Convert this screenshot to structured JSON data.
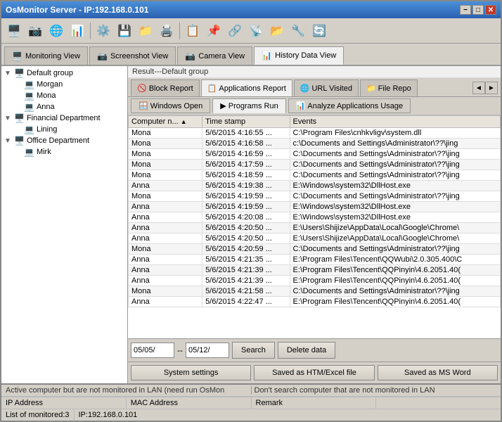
{
  "window": {
    "title": "OsMonitor Server - IP:192.168.0.101",
    "minimize": "−",
    "maximize": "□",
    "close": "✕"
  },
  "toolbar": {
    "icons": [
      "🖥️",
      "📷",
      "🌐",
      "📊",
      "⚙️",
      "💾",
      "📁",
      "🖨️",
      "📋",
      "📌",
      "🔗",
      "📡",
      "📂",
      "🔧",
      "🔄"
    ]
  },
  "tabs": [
    {
      "label": "Monitoring View",
      "icon": "🖥️",
      "active": false
    },
    {
      "label": "Screenshot View",
      "icon": "📷",
      "active": false
    },
    {
      "label": "Camera View",
      "icon": "📷",
      "active": false
    },
    {
      "label": "History Data View",
      "icon": "📊",
      "active": true
    }
  ],
  "sidebar": {
    "tree": [
      {
        "label": "Default group",
        "icon": "🖥️",
        "type": "group",
        "expanded": true,
        "children": [
          {
            "label": "Morgan",
            "icon": "💻",
            "type": "computer"
          },
          {
            "label": "Mona",
            "icon": "💻",
            "type": "computer"
          },
          {
            "label": "Anna",
            "icon": "💻",
            "type": "computer"
          }
        ]
      },
      {
        "label": "Financial Department",
        "icon": "🖥️",
        "type": "group",
        "expanded": true,
        "children": [
          {
            "label": "Lining",
            "icon": "💻",
            "type": "computer"
          }
        ]
      },
      {
        "label": "Office Department",
        "icon": "🖥️",
        "type": "group",
        "expanded": true,
        "children": [
          {
            "label": "Mirk",
            "icon": "💻",
            "type": "computer"
          }
        ]
      }
    ]
  },
  "result_label": "Result---Default group",
  "sub_tabs": [
    {
      "label": "Block Report",
      "icon": "🚫",
      "active": false
    },
    {
      "label": "Applications Report",
      "icon": "📋",
      "active": true
    },
    {
      "label": "URL Visited",
      "icon": "🌐",
      "active": false
    },
    {
      "label": "File Repo",
      "icon": "📁",
      "active": false
    }
  ],
  "action_tabs": [
    {
      "label": "Windows Open",
      "icon": "🪟"
    },
    {
      "label": "Programs Run",
      "icon": "▶️"
    },
    {
      "label": "Analyze Applications Usage",
      "icon": "📊"
    }
  ],
  "table": {
    "columns": [
      "Computer n...",
      "Time stamp",
      "Events"
    ],
    "rows": [
      [
        "Mona",
        "5/6/2015 4:16:55 ...",
        "C:\\Program Files\\cnhkvligv\\system.dll"
      ],
      [
        "Mona",
        "5/6/2015 4:16:58 ...",
        "c:\\Documents and Settings\\Administrator\\??\\jing"
      ],
      [
        "Mona",
        "5/6/2015 4:16:59 ...",
        "C:\\Documents and Settings\\Administrator\\??\\jing"
      ],
      [
        "Mona",
        "5/6/2015 4:17:59 ...",
        "C:\\Documents and Settings\\Administrator\\??\\jing"
      ],
      [
        "Mona",
        "5/6/2015 4:18:59 ...",
        "C:\\Documents and Settings\\Administrator\\??\\jing"
      ],
      [
        "Anna",
        "5/6/2015 4:19:38 ...",
        "E:\\Windows\\system32\\DllHost.exe"
      ],
      [
        "Mona",
        "5/6/2015 4:19:59 ...",
        "C:\\Documents and Settings\\Administrator\\??\\jing"
      ],
      [
        "Anna",
        "5/6/2015 4:19:59 ...",
        "E:\\Windows\\system32\\DllHost.exe"
      ],
      [
        "Anna",
        "5/6/2015 4:20:08 ...",
        "E:\\Windows\\system32\\DllHost.exe"
      ],
      [
        "Anna",
        "5/6/2015 4:20:50 ...",
        "E:\\Users\\Shijize\\AppData\\Local\\Google\\Chrome\\"
      ],
      [
        "Anna",
        "5/6/2015 4:20:50 ...",
        "E:\\Users\\Shijize\\AppData\\Local\\Google\\Chrome\\"
      ],
      [
        "Mona",
        "5/6/2015 4:20:59 ...",
        "C:\\Documents and Settings\\Administrator\\??\\jing"
      ],
      [
        "Anna",
        "5/6/2015 4:21:35 ...",
        "E:\\Program Files\\Tencent\\QQWubi\\2.0.305.400\\C"
      ],
      [
        "Anna",
        "5/6/2015 4:21:39 ...",
        "E:\\Program Files\\Tencent\\QQPinyin\\4.6.2051.40("
      ],
      [
        "Anna",
        "5/6/2015 4:21:39 ...",
        "E:\\Program Files\\Tencent\\QQPinyin\\4.6.2051.40("
      ],
      [
        "Mona",
        "5/6/2015 4:21:58 ...",
        "C:\\Documents and Settings\\Administrator\\??\\jing"
      ],
      [
        "Anna",
        "5/6/2015 4:22:47 ...",
        "E:\\Program Files\\Tencent\\QQPinyin\\4.6.2051.40("
      ]
    ]
  },
  "date_from": "05/05/",
  "date_to": "05/12/",
  "buttons": {
    "search": "Search",
    "delete": "Delete data",
    "system_settings": "System settings",
    "save_htm": "Saved as HTM/Excel file",
    "save_word": "Saved as MS Word"
  },
  "status": {
    "warning_left": "Active computer but are not monitored in LAN (need run OsMon",
    "warning_right": "Don't search computer that are not monitored in LAN",
    "ip_label": "IP Address",
    "mac_label": "MAC Address",
    "remark_label": "Remark",
    "monitored": "List of monitored:3",
    "ip": "IP:192.168.0.101"
  }
}
